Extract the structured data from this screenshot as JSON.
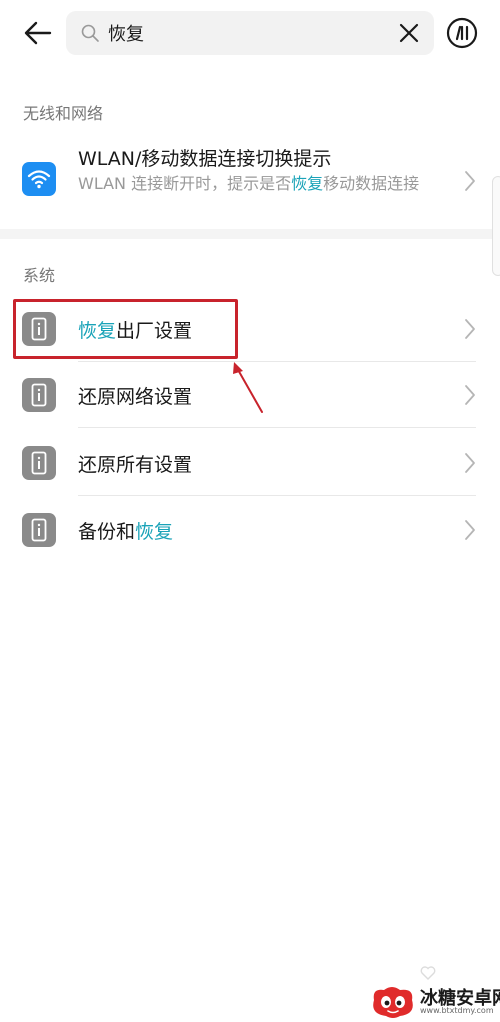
{
  "search": {
    "query": "恢复",
    "placeholder": ""
  },
  "sections": [
    {
      "header": "无线和网络",
      "items": [
        {
          "icon": "wifi-icon",
          "title": "WLAN/移动数据连接切换提示",
          "desc_before": "WLAN 连接断开时，提示是否",
          "desc_highlight": "恢复",
          "desc_after": "移动数据连接"
        }
      ]
    },
    {
      "header": "系统",
      "items": [
        {
          "icon": "phone-info-icon",
          "label_highlight": "恢复",
          "label_after": "出厂设置",
          "highlighted": true
        },
        {
          "icon": "phone-info-icon",
          "label_before": "还原网络设置"
        },
        {
          "icon": "phone-info-icon",
          "label_before": "还原所有设置"
        },
        {
          "icon": "phone-info-icon",
          "label_before": "备份和",
          "label_highlight": "恢复"
        }
      ]
    }
  ],
  "colors": {
    "highlight_text": "#1aa3b8",
    "wifi_icon_bg": "#1d8ef2",
    "system_icon_bg": "#8a8a8a",
    "annotation_red": "#c8232c"
  },
  "watermark": {
    "title": "冰糖安卓网",
    "url": "www.btxtdmy.com"
  }
}
